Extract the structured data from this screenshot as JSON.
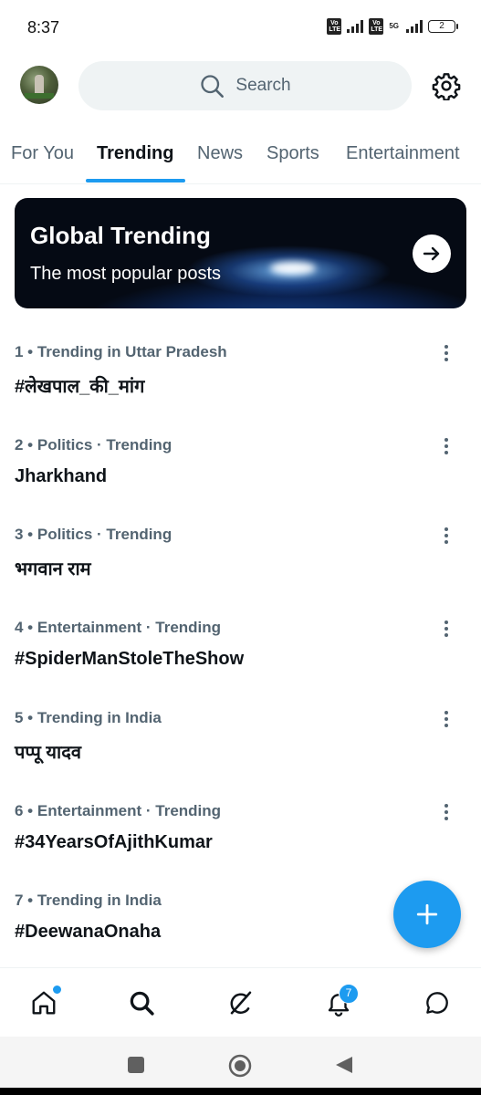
{
  "status_bar": {
    "time": "8:37",
    "sim1_label": "Vo LTE",
    "sim2_label": "Vo LTE",
    "network": "5G",
    "battery": "2"
  },
  "header": {
    "search_placeholder": "Search"
  },
  "tabs": [
    {
      "label": "For You",
      "active": false
    },
    {
      "label": "Trending",
      "active": true
    },
    {
      "label": "News",
      "active": false
    },
    {
      "label": "Sports",
      "active": false
    },
    {
      "label": "Entertainment",
      "active": false
    }
  ],
  "banner": {
    "title": "Global Trending",
    "subtitle": "The most popular posts"
  },
  "trends": [
    {
      "meta": "1 • Trending in Uttar Pradesh",
      "name": "#लेखपाल_की_मांग"
    },
    {
      "meta": "2 • Politics · Trending",
      "name": "Jharkhand"
    },
    {
      "meta": "3 • Politics · Trending",
      "name": "भगवान राम"
    },
    {
      "meta": "4 • Entertainment · Trending",
      "name": "#SpiderManStoleTheShow"
    },
    {
      "meta": "5 • Trending in India",
      "name": "पप्पू यादव"
    },
    {
      "meta": "6 • Entertainment · Trending",
      "name": "#34YearsOfAjithKumar"
    },
    {
      "meta": "7 • Trending in India",
      "name": "#DeewanaOnaha"
    }
  ],
  "bottom_nav": {
    "items": [
      "home-icon",
      "search-icon",
      "grok-icon",
      "notifications-icon",
      "messages-icon"
    ],
    "notification_count": "7"
  },
  "colors": {
    "accent": "#1d9bf0",
    "text_primary": "#0f1419",
    "text_secondary": "#536471"
  }
}
